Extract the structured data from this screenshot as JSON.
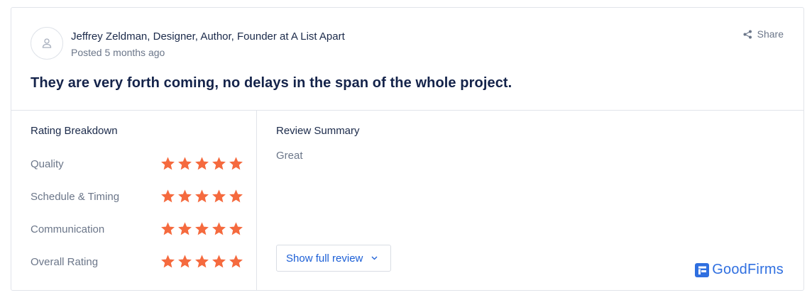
{
  "review": {
    "author": "Jeffrey Zeldman, Designer, Author, Founder at A List Apart",
    "posted": "Posted 5 months ago",
    "share_label": "Share",
    "headline": "They are very forth coming, no delays in the span of the whole project."
  },
  "rating_breakdown": {
    "title": "Rating Breakdown",
    "items": [
      {
        "label": "Quality",
        "stars": 5
      },
      {
        "label": "Schedule & Timing",
        "stars": 5
      },
      {
        "label": "Communication",
        "stars": 5
      },
      {
        "label": "Overall Rating",
        "stars": 5
      }
    ],
    "max_stars": 5
  },
  "summary": {
    "title": "Review Summary",
    "text": "Great",
    "show_full_label": "Show full review"
  },
  "brand": {
    "name": "GoodFirms",
    "color": "#2f6fe0"
  },
  "colors": {
    "star": "#f56a3e",
    "link": "#1c5fd6",
    "heading": "#14234a"
  },
  "icons": {
    "avatar": "user-icon",
    "share": "share-icon",
    "chevron": "chevron-down-icon",
    "star": "star-icon",
    "logo": "goodfirms-logo-icon"
  }
}
